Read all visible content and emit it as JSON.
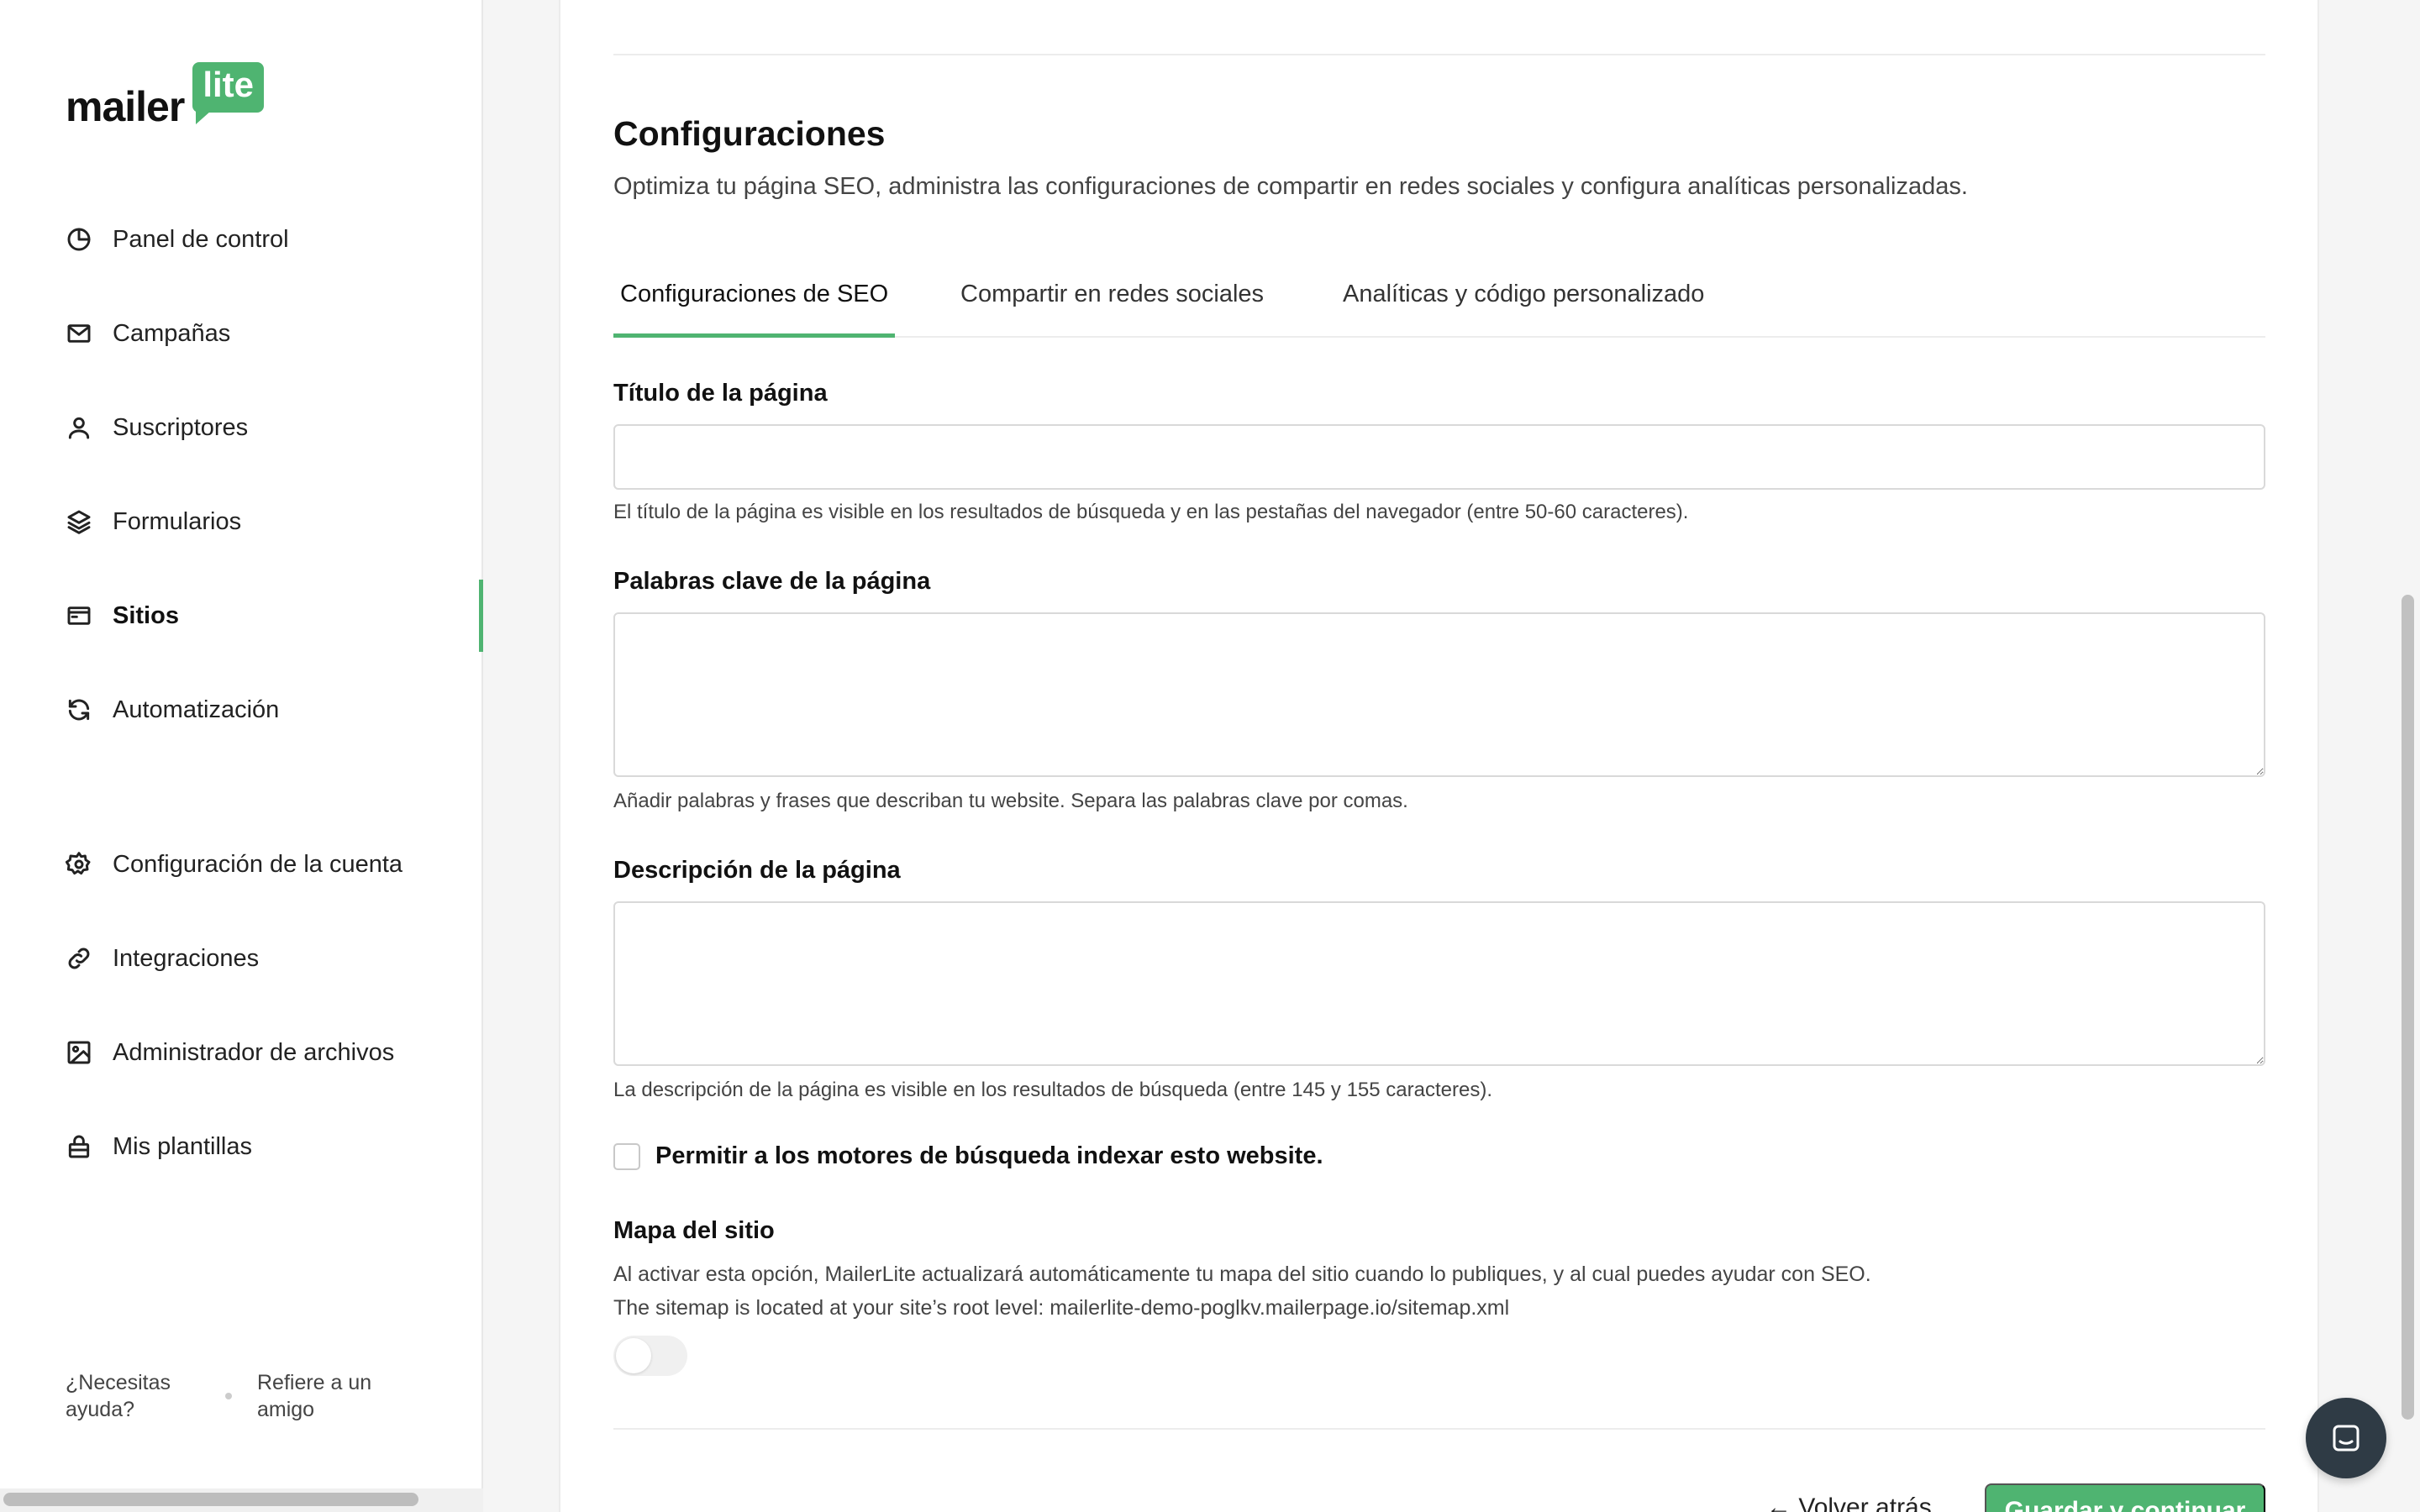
{
  "brand": {
    "name": "mailer",
    "badge": "lite",
    "accent": "#4fb471"
  },
  "sidebar": {
    "items": [
      {
        "label": "Panel de control",
        "icon": "dashboard-icon"
      },
      {
        "label": "Campañas",
        "icon": "mail-icon"
      },
      {
        "label": "Suscriptores",
        "icon": "user-icon"
      },
      {
        "label": "Formularios",
        "icon": "layers-icon"
      },
      {
        "label": "Sitios",
        "icon": "browser-icon",
        "active": true
      },
      {
        "label": "Automatización",
        "icon": "refresh-icon"
      },
      {
        "label": "Configuración de la cuenta",
        "icon": "gear-icon"
      },
      {
        "label": "Integraciones",
        "icon": "link-icon"
      },
      {
        "label": "Administrador de archivos",
        "icon": "image-icon"
      },
      {
        "label": "Mis plantillas",
        "icon": "lock-icon"
      }
    ],
    "footer": {
      "help": "¿Necesitas ayuda?",
      "refer": "Refiere a un amigo"
    }
  },
  "settings": {
    "title": "Configuraciones",
    "subtitle": "Optimiza tu página SEO, administra las configuraciones de compartir en redes sociales y configura analíticas personalizadas.",
    "tabs": [
      {
        "label": "Configuraciones de SEO",
        "active": true
      },
      {
        "label": "Compartir en redes sociales"
      },
      {
        "label": "Analíticas y código personalizado"
      }
    ],
    "page_title": {
      "label": "Título de la página",
      "value": "",
      "help": "El título de la página es visible en los resultados de búsqueda y en las pestañas del navegador (entre 50-60 caracteres)."
    },
    "keywords": {
      "label": "Palabras clave de la página",
      "value": "",
      "help": "Añadir palabras y frases que describan tu website. Separa las palabras clave por comas."
    },
    "description": {
      "label": "Descripción de la página",
      "value": "",
      "help": "La descripción de la página es visible en los resultados de búsqueda (entre 145 y 155 caracteres)."
    },
    "indexing": {
      "label": "Permitir a los motores de búsqueda indexar esto website.",
      "checked": false
    },
    "sitemap": {
      "label": "Mapa del sitio",
      "help1": "Al activar esta opción, MailerLite actualizará automáticamente tu mapa del sitio cuando lo publiques, y al cual puedes ayudar con SEO.",
      "help2": "The sitemap is located at your site’s root level: mailerlite-demo-poglkv.mailerpage.io/sitemap.xml",
      "enabled": false
    },
    "actions": {
      "back": "← Volver atrás",
      "save": "Guardar y continuar"
    }
  }
}
